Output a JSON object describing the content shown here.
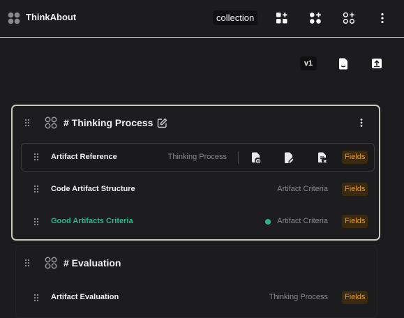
{
  "header": {
    "app_title": "ThinkAbout",
    "collection_label": "collection",
    "buttons": [
      "add-card-icon",
      "add-group-icon",
      "add-outline-icon",
      "more-vertical-icon"
    ]
  },
  "toolbar": {
    "version_label": "v1",
    "buttons": [
      "file-download-icon",
      "upload-icon"
    ]
  },
  "groups": [
    {
      "title": "# Thinking Process",
      "items": [
        {
          "name": "Artifact Reference",
          "category": "Thinking Process",
          "fields_label": "Fields",
          "selected": true
        },
        {
          "name": "Code Artifact Structure",
          "category": "Artifact Criteria",
          "fields_label": "Fields"
        },
        {
          "name": "Good Artifacts Criteria",
          "category": "Artifact Criteria",
          "fields_label": "Fields",
          "active": true
        }
      ]
    },
    {
      "title": "# Evaluation",
      "items": [
        {
          "name": "Artifact Evaluation",
          "category": "Thinking Process",
          "fields_label": "Fields"
        }
      ]
    }
  ],
  "colors": {
    "background": "#1c1c1e",
    "accent_green": "#2fb585",
    "fields_orange": "#e09a2a",
    "group_border": "#c9c9bd"
  }
}
